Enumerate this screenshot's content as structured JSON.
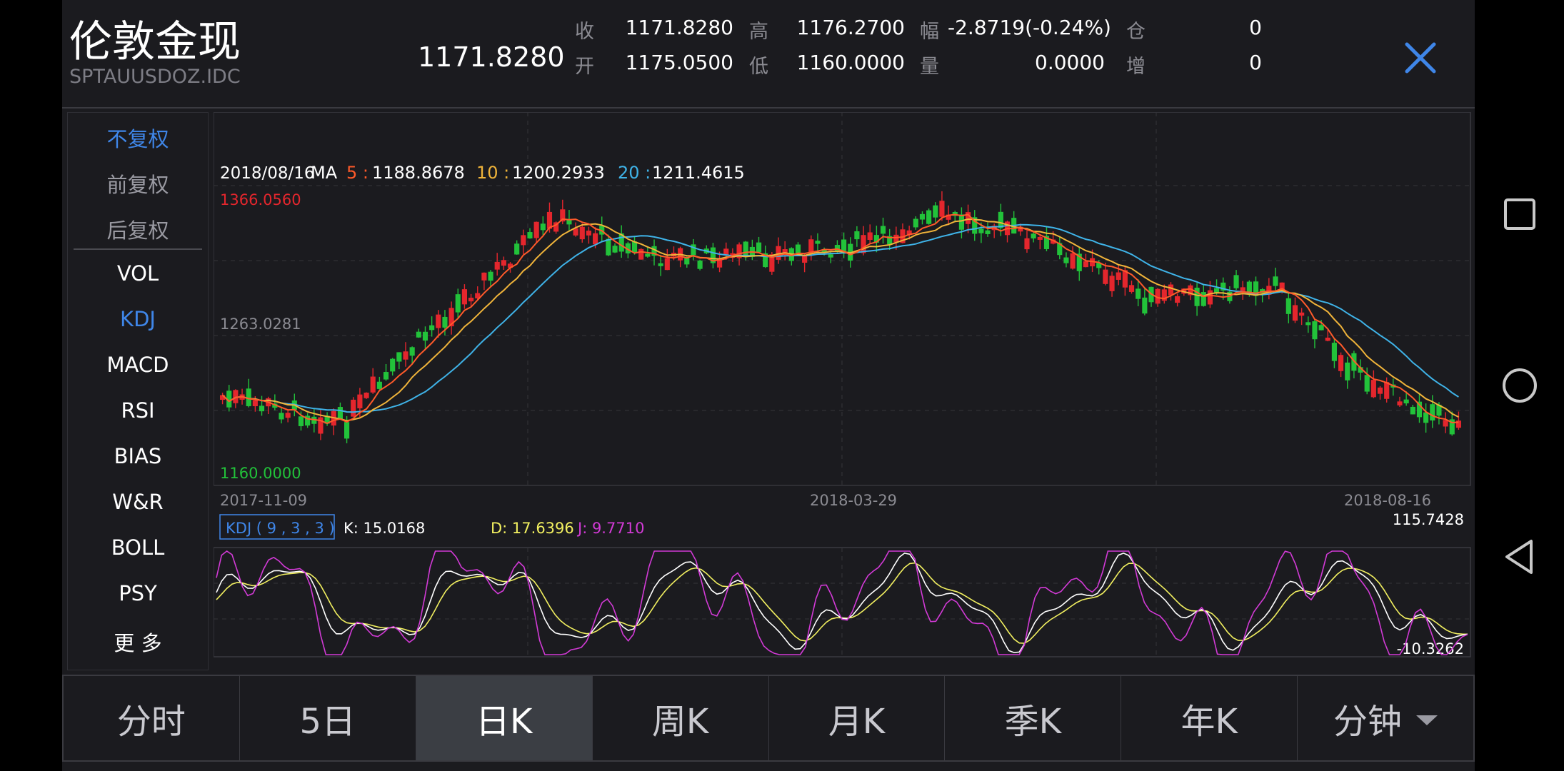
{
  "header": {
    "title": "伦敦金现",
    "code": "SPTAUUSDOZ.IDC",
    "price": "1171.8280",
    "quotes": [
      {
        "label": "收",
        "value": "1171.8280"
      },
      {
        "label": "高",
        "value": "1176.2700"
      },
      {
        "label": "幅",
        "value": "-2.8719(-0.24%)"
      },
      {
        "label": "仓",
        "value": "0"
      },
      {
        "label": "开",
        "value": "1175.0500"
      },
      {
        "label": "低",
        "value": "1160.0000"
      },
      {
        "label": "量",
        "value": "0.0000"
      },
      {
        "label": "增",
        "value": "0"
      }
    ]
  },
  "menu": {
    "rights": [
      "不复权",
      "前复权",
      "后复权"
    ],
    "indicators": [
      "VOL",
      "KDJ",
      "MACD",
      "RSI",
      "BIAS",
      "W&R",
      "BOLL",
      "PSY",
      "更 多"
    ]
  },
  "chart": {
    "ma_line": {
      "date": "2018/08/16",
      "prefix": "MA",
      "ma5_label": "5 :",
      "ma5_value": "1188.8678",
      "ma10_label": "10 :",
      "ma10_value": "1200.2933",
      "ma20_label": "20 :",
      "ma20_value": "1211.4615"
    },
    "price_high_label": "1366.0560",
    "price_mid_label": "1263.0281",
    "price_low_label": "1160.0000",
    "dates": [
      "2017-11-09",
      "2018-03-29",
      "2018-08-16"
    ],
    "kdj": {
      "name": "KDJ ( 9 , 3 , 3 )",
      "k": "K: 15.0168",
      "d": "D: 17.6396",
      "j": "J: 9.7710",
      "max_label": "115.7428",
      "min_label": "-10.3262"
    },
    "colors": {
      "up": "#e4262d",
      "down": "#22c23a",
      "ma5": "#ff5a2a",
      "ma10": "#f0b43a",
      "ma20": "#3fb3e8",
      "k": "#ffffff",
      "d": "#f2f060",
      "j": "#d23ad6"
    }
  },
  "tabs": [
    "分时",
    "5日",
    "日K",
    "周K",
    "月K",
    "季K",
    "年K",
    "分钟"
  ],
  "sysnav": [
    "square-icon",
    "circle-icon",
    "back-triangle-icon"
  ]
}
